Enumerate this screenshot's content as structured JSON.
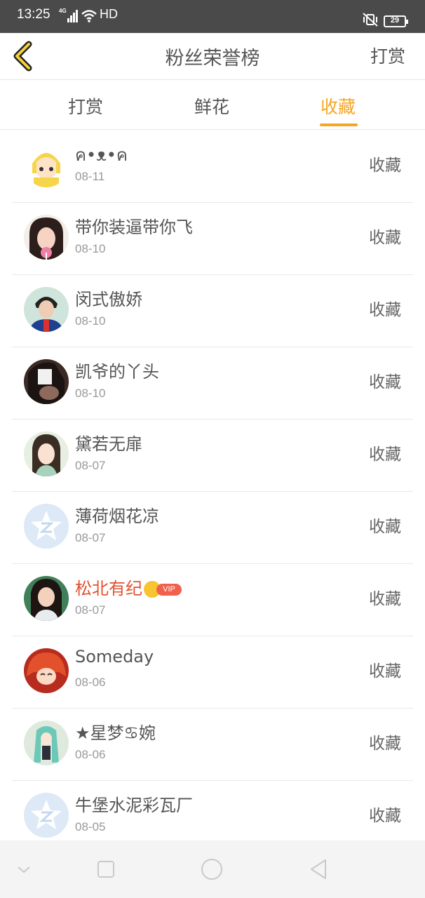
{
  "status_bar": {
    "time": "13:25",
    "network": "4G",
    "hd": "HD",
    "battery": "29"
  },
  "header": {
    "title": "粉丝荣誉榜",
    "right_action": "打赏"
  },
  "tabs": [
    {
      "label": "打赏",
      "active": false
    },
    {
      "label": "鲜花",
      "active": false
    },
    {
      "label": "收藏",
      "active": true
    }
  ],
  "accent_color": "#f5a623",
  "vip_name_color": "#e0532f",
  "fans": [
    {
      "name": "ค•ᴥ•ค",
      "date": "08-11",
      "action": "收藏",
      "avatar": "cartoon-girl-avatar"
    },
    {
      "name": "带你装逼带你飞",
      "date": "08-10",
      "action": "收藏",
      "avatar": "girl-lollipop-avatar"
    },
    {
      "name": "闵式傲娇",
      "date": "08-10",
      "action": "收藏",
      "avatar": "boy-singer-avatar"
    },
    {
      "name": "凯爷的丫头",
      "date": "08-10",
      "action": "收藏",
      "avatar": "dark-photo-avatar"
    },
    {
      "name": "黛若无扉",
      "date": "08-07",
      "action": "收藏",
      "avatar": "anime-girl-avatar"
    },
    {
      "name": "薄荷烟花凉",
      "date": "08-07",
      "action": "收藏",
      "avatar": "default-star-avatar"
    },
    {
      "name": "松北有纪",
      "date": "08-07",
      "action": "收藏",
      "avatar": "woman-photo-avatar",
      "vip": true,
      "vip_label": "VIP"
    },
    {
      "name": "Someday",
      "date": "08-06",
      "action": "收藏",
      "avatar": "red-anime-avatar"
    },
    {
      "name": "★星梦♋婉",
      "date": "08-06",
      "action": "收藏",
      "avatar": "green-anime-avatar"
    },
    {
      "name": "牛堡水泥彩瓦厂",
      "date": "08-05",
      "action": "收藏",
      "avatar": "default-star-avatar"
    }
  ],
  "nav_bar": {
    "buttons": [
      "chevron-down-icon",
      "square-icon",
      "circle-icon",
      "triangle-back-icon"
    ]
  }
}
